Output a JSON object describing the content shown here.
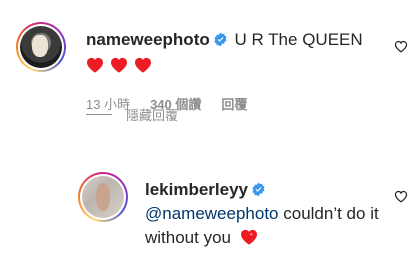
{
  "comment": {
    "username": "nameweephoto",
    "text": "U R The QUEEN",
    "emoji_hearts": 3,
    "meta": {
      "time": "13 小時",
      "likes": "340 個讚",
      "reply": "回覆"
    }
  },
  "hide_replies": "隱藏回覆",
  "reply": {
    "username": "lekimberleyy",
    "mention": "@nameweephoto",
    "text": " couldn’t do it without you"
  },
  "colors": {
    "heart": "#ed1c24",
    "verified": "#3897f0",
    "mention": "#00376b",
    "muted": "#8e8e8e"
  },
  "icons": [
    "verified-badge-icon",
    "heart-emoji-icon",
    "like-heart-icon",
    "sparkle-heart-emoji-icon"
  ]
}
